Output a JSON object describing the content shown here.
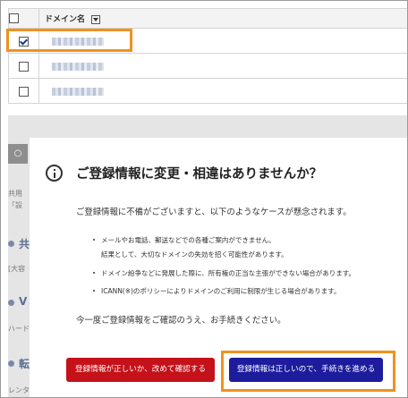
{
  "table": {
    "header": "ドメイン名",
    "rows": [
      {
        "checked": true
      },
      {
        "checked": false
      },
      {
        "checked": false
      }
    ]
  },
  "background": {
    "lines": [
      "共用",
      "「設",
      "共",
      "[大容",
      "V",
      "ハード",
      "転",
      "レンタ"
    ]
  },
  "modal": {
    "title": "ご登録情報に変更・相違はありませんか？",
    "lead": "ご登録情報に不備がございますと、以下のようなケースが懸念されます。",
    "bullets": [
      "メールやお電話、郵送などでの各種ご案内ができません。",
      "結果として、大切なドメインの失効を招く可能性があります。",
      "ドメイン紛争などに発展した際に、所有権の正当な主張ができない場合があります。",
      "ICANN(※)のポリシーによりドメインのご利用に制限が生じる場合があります。"
    ],
    "note": "今一度ご登録情報をご確認のうえ、お手続きください。",
    "btn_recheck": "登録情報が正しいか、改めて確認する",
    "btn_proceed": "登録情報は正しいので、手続きを進める"
  },
  "colors": {
    "highlight": "#f0921e",
    "red_button": "#c4111a",
    "navy_button": "#1c1c9c"
  }
}
